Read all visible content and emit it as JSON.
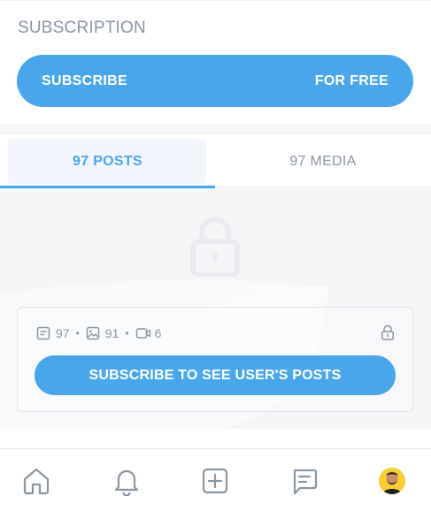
{
  "subscription": {
    "title": "SUBSCRIPTION",
    "subscribe_label": "SUBSCRIBE",
    "price_label": "FOR FREE"
  },
  "tabs": [
    {
      "label": "97 POSTS",
      "active": true
    },
    {
      "label": "97 MEDIA",
      "active": false
    }
  ],
  "locked_content": {
    "lock_icon": "lock-icon",
    "stats": {
      "posts": "97",
      "photos": "91",
      "videos": "6"
    },
    "cta_label": "SUBSCRIBE TO SEE USER'S POSTS"
  },
  "bottom_nav": {
    "items": [
      "home-icon",
      "bell-icon",
      "add-post-icon",
      "messages-icon",
      "avatar"
    ]
  },
  "colors": {
    "accent": "#4aa6ea",
    "muted_text": "#8a96a3",
    "locked_bg": "#f4f5f7",
    "avatar_bg": "#f5d033"
  }
}
